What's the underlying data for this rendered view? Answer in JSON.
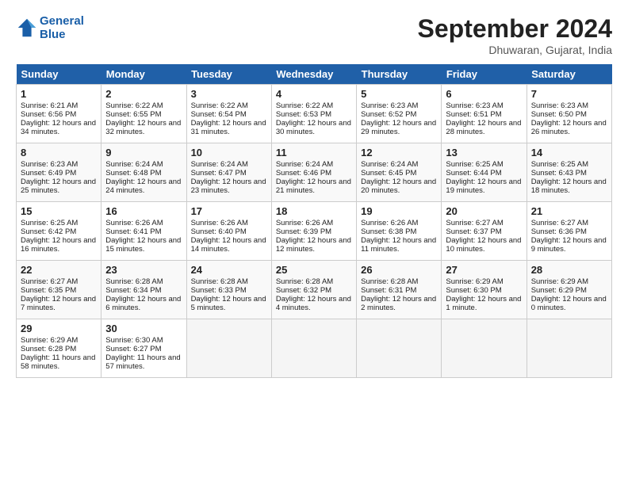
{
  "header": {
    "logo_line1": "General",
    "logo_line2": "Blue",
    "month": "September 2024",
    "location": "Dhuwaran, Gujarat, India"
  },
  "days_of_week": [
    "Sunday",
    "Monday",
    "Tuesday",
    "Wednesday",
    "Thursday",
    "Friday",
    "Saturday"
  ],
  "weeks": [
    [
      {
        "day": "1",
        "sunrise": "6:21 AM",
        "sunset": "6:56 PM",
        "daylight": "12 hours and 34 minutes."
      },
      {
        "day": "2",
        "sunrise": "6:22 AM",
        "sunset": "6:55 PM",
        "daylight": "12 hours and 32 minutes."
      },
      {
        "day": "3",
        "sunrise": "6:22 AM",
        "sunset": "6:54 PM",
        "daylight": "12 hours and 31 minutes."
      },
      {
        "day": "4",
        "sunrise": "6:22 AM",
        "sunset": "6:53 PM",
        "daylight": "12 hours and 30 minutes."
      },
      {
        "day": "5",
        "sunrise": "6:23 AM",
        "sunset": "6:52 PM",
        "daylight": "12 hours and 29 minutes."
      },
      {
        "day": "6",
        "sunrise": "6:23 AM",
        "sunset": "6:51 PM",
        "daylight": "12 hours and 28 minutes."
      },
      {
        "day": "7",
        "sunrise": "6:23 AM",
        "sunset": "6:50 PM",
        "daylight": "12 hours and 26 minutes."
      }
    ],
    [
      {
        "day": "8",
        "sunrise": "6:23 AM",
        "sunset": "6:49 PM",
        "daylight": "12 hours and 25 minutes."
      },
      {
        "day": "9",
        "sunrise": "6:24 AM",
        "sunset": "6:48 PM",
        "daylight": "12 hours and 24 minutes."
      },
      {
        "day": "10",
        "sunrise": "6:24 AM",
        "sunset": "6:47 PM",
        "daylight": "12 hours and 23 minutes."
      },
      {
        "day": "11",
        "sunrise": "6:24 AM",
        "sunset": "6:46 PM",
        "daylight": "12 hours and 21 minutes."
      },
      {
        "day": "12",
        "sunrise": "6:24 AM",
        "sunset": "6:45 PM",
        "daylight": "12 hours and 20 minutes."
      },
      {
        "day": "13",
        "sunrise": "6:25 AM",
        "sunset": "6:44 PM",
        "daylight": "12 hours and 19 minutes."
      },
      {
        "day": "14",
        "sunrise": "6:25 AM",
        "sunset": "6:43 PM",
        "daylight": "12 hours and 18 minutes."
      }
    ],
    [
      {
        "day": "15",
        "sunrise": "6:25 AM",
        "sunset": "6:42 PM",
        "daylight": "12 hours and 16 minutes."
      },
      {
        "day": "16",
        "sunrise": "6:26 AM",
        "sunset": "6:41 PM",
        "daylight": "12 hours and 15 minutes."
      },
      {
        "day": "17",
        "sunrise": "6:26 AM",
        "sunset": "6:40 PM",
        "daylight": "12 hours and 14 minutes."
      },
      {
        "day": "18",
        "sunrise": "6:26 AM",
        "sunset": "6:39 PM",
        "daylight": "12 hours and 12 minutes."
      },
      {
        "day": "19",
        "sunrise": "6:26 AM",
        "sunset": "6:38 PM",
        "daylight": "12 hours and 11 minutes."
      },
      {
        "day": "20",
        "sunrise": "6:27 AM",
        "sunset": "6:37 PM",
        "daylight": "12 hours and 10 minutes."
      },
      {
        "day": "21",
        "sunrise": "6:27 AM",
        "sunset": "6:36 PM",
        "daylight": "12 hours and 9 minutes."
      }
    ],
    [
      {
        "day": "22",
        "sunrise": "6:27 AM",
        "sunset": "6:35 PM",
        "daylight": "12 hours and 7 minutes."
      },
      {
        "day": "23",
        "sunrise": "6:28 AM",
        "sunset": "6:34 PM",
        "daylight": "12 hours and 6 minutes."
      },
      {
        "day": "24",
        "sunrise": "6:28 AM",
        "sunset": "6:33 PM",
        "daylight": "12 hours and 5 minutes."
      },
      {
        "day": "25",
        "sunrise": "6:28 AM",
        "sunset": "6:32 PM",
        "daylight": "12 hours and 4 minutes."
      },
      {
        "day": "26",
        "sunrise": "6:28 AM",
        "sunset": "6:31 PM",
        "daylight": "12 hours and 2 minutes."
      },
      {
        "day": "27",
        "sunrise": "6:29 AM",
        "sunset": "6:30 PM",
        "daylight": "12 hours and 1 minute."
      },
      {
        "day": "28",
        "sunrise": "6:29 AM",
        "sunset": "6:29 PM",
        "daylight": "12 hours and 0 minutes."
      }
    ],
    [
      {
        "day": "29",
        "sunrise": "6:29 AM",
        "sunset": "6:28 PM",
        "daylight": "11 hours and 58 minutes."
      },
      {
        "day": "30",
        "sunrise": "6:30 AM",
        "sunset": "6:27 PM",
        "daylight": "11 hours and 57 minutes."
      },
      null,
      null,
      null,
      null,
      null
    ]
  ]
}
